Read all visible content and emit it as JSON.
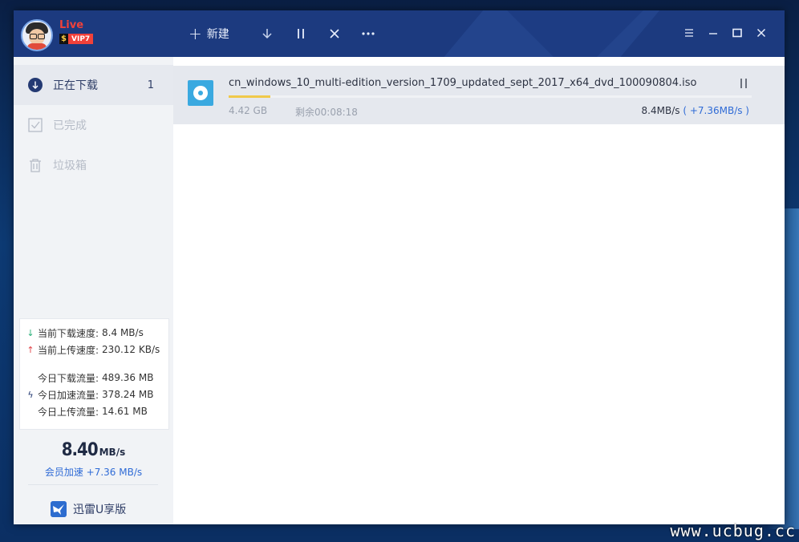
{
  "window": {
    "user": {
      "name": "Live",
      "vip_badge_symbol": "$",
      "vip_badge": "VIP7"
    },
    "toolbar": {
      "new_label": "新建",
      "new_icon": "plus-icon",
      "download_icon": "download-arrow-icon",
      "pause_icon": "pause-icon",
      "delete_icon": "close-icon",
      "more_icon": "more-icon"
    },
    "window_controls": [
      "menu-icon",
      "minimize-icon",
      "maximize-icon",
      "close-icon"
    ]
  },
  "sidebar": {
    "items": [
      {
        "label": "正在下载",
        "count": "1",
        "icon": "download-circle-icon",
        "active": true
      },
      {
        "label": "已完成",
        "count": "",
        "icon": "checkbox-icon",
        "active": false
      },
      {
        "label": "垃圾箱",
        "count": "",
        "icon": "trash-icon",
        "active": false
      }
    ],
    "stats": {
      "download_speed_label": "当前下载速度:",
      "download_speed": "8.4 MB/s",
      "upload_speed_label": "当前上传速度:",
      "upload_speed": "230.12 KB/s",
      "today_download_label": "今日下载流量:",
      "today_download": "489.36 MB",
      "today_accel_label": "今日加速流量:",
      "today_accel": "378.24 MB",
      "today_upload_label": "今日上传流量:",
      "today_upload": "14.61 MB"
    },
    "big_speed": {
      "value": "8.40",
      "unit": "MB/s"
    },
    "vip_accel": "会员加速 +7.36 MB/s",
    "u_version": "迅雷U享版"
  },
  "tasks": [
    {
      "file_name": "cn_windows_10_multi-edition_version_1709_updated_sept_2017_x64_dvd_100090804.iso",
      "size": "4.42 GB",
      "remaining": "剩余00:08:18",
      "speed": "8.4MB/s",
      "boost": "( +7.36MB/s )",
      "progress": 0.08
    }
  ],
  "watermark": "www.ucbug.cc",
  "colors": {
    "titlebar": "#1c3a7f",
    "accent": "#2f6bd6",
    "progress": "#f0c94a",
    "vip": "#f0413a"
  }
}
